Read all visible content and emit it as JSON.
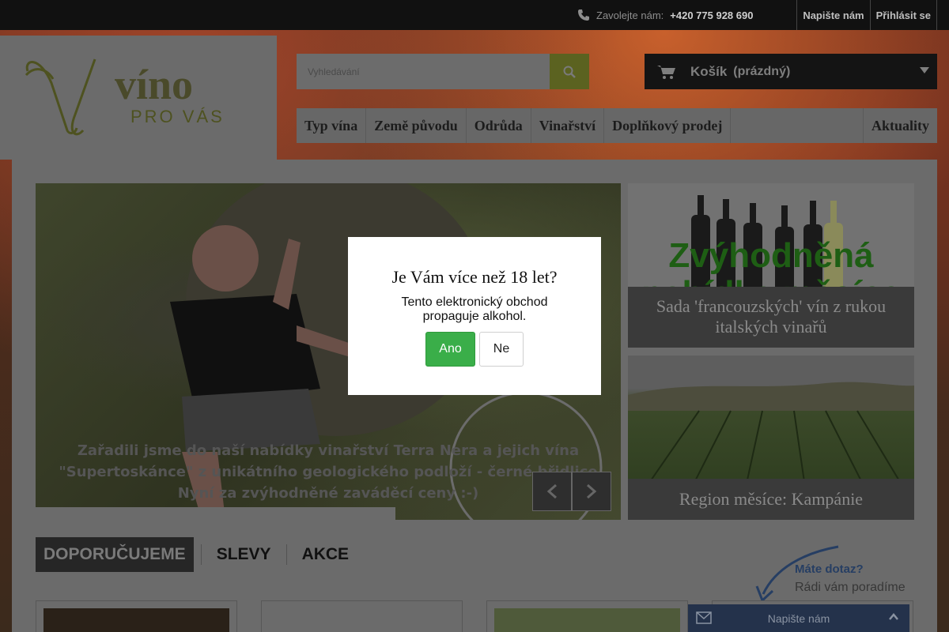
{
  "topbar": {
    "phone_label": "Zavolejte nám:",
    "phone_number": "+420 775 928 690",
    "links": [
      "Napište nám",
      "Přihlásit se"
    ]
  },
  "logo": {
    "main": "víno",
    "sub": "PRO VÁS",
    "icon": "v-logo-icon"
  },
  "search": {
    "placeholder": "Vyhledávání",
    "icon": "search-icon"
  },
  "cart": {
    "label": "Košík",
    "status": "(prázdný)",
    "icon": "cart-icon"
  },
  "menu": {
    "items": [
      "Typ vína",
      "Země původu",
      "Odrůda",
      "Vinařství",
      "Doplňkový prodej"
    ],
    "right": "Aktuality"
  },
  "slider": {
    "caption_lines": [
      "Zařadili jsme do naší nabídky vinařství Terra Nera a jejich vína",
      "\"Supertoskánce\"  z unikátního geologického podloží - černé břidlice",
      "Nyní za zvýhodněné zaváděcí ceny :-)"
    ]
  },
  "banners": [
    {
      "headline_lines": [
        "Zvýhodněná",
        "nabídka měsíce"
      ],
      "caption_lines": [
        "Sada 'francouzských' vín z rukou",
        "italských vinařů"
      ]
    },
    {
      "caption": "Region měsíce: Kampánie"
    }
  ],
  "tabs": [
    "DOPORUČUJEME",
    "SLEVY",
    "AKCE"
  ],
  "ask": {
    "question": "Máte dotaz?",
    "answer": "Rádi vám poradíme"
  },
  "chat": {
    "label": "Napište nám"
  },
  "modal": {
    "title": "Je Vám více než 18 let?",
    "text_lines": [
      "Tento elektronický obchod",
      "propaguje alkohol."
    ],
    "yes": "Ano",
    "no": "Ne"
  },
  "colors": {
    "accent_green": "#3aae49",
    "brand_olive": "#5b6220",
    "chat_navy": "#24324b"
  }
}
